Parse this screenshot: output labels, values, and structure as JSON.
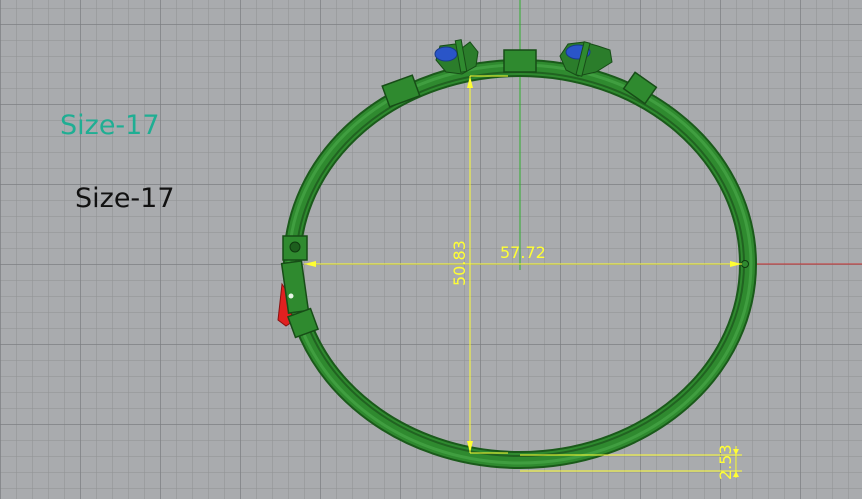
{
  "labels": {
    "size_primary": "Size-17",
    "size_secondary": "Size-17"
  },
  "dimensions": {
    "width": "57.72",
    "height": "50.83",
    "thickness": "2.53"
  },
  "colors": {
    "viewport_bg": "#a9abae",
    "grid_major": "#7f8185",
    "grid_minor": "#929497",
    "ring_green": "#2f8a2f",
    "ring_dark": "#1d5e1d",
    "dimension_yellow": "#ffff33",
    "axis_x_red": "#cc3333",
    "axis_y_green": "#33aa33",
    "label_teal": "#1fae93",
    "stone_blue": "#2a55c8",
    "clasp_red": "#e12020"
  }
}
